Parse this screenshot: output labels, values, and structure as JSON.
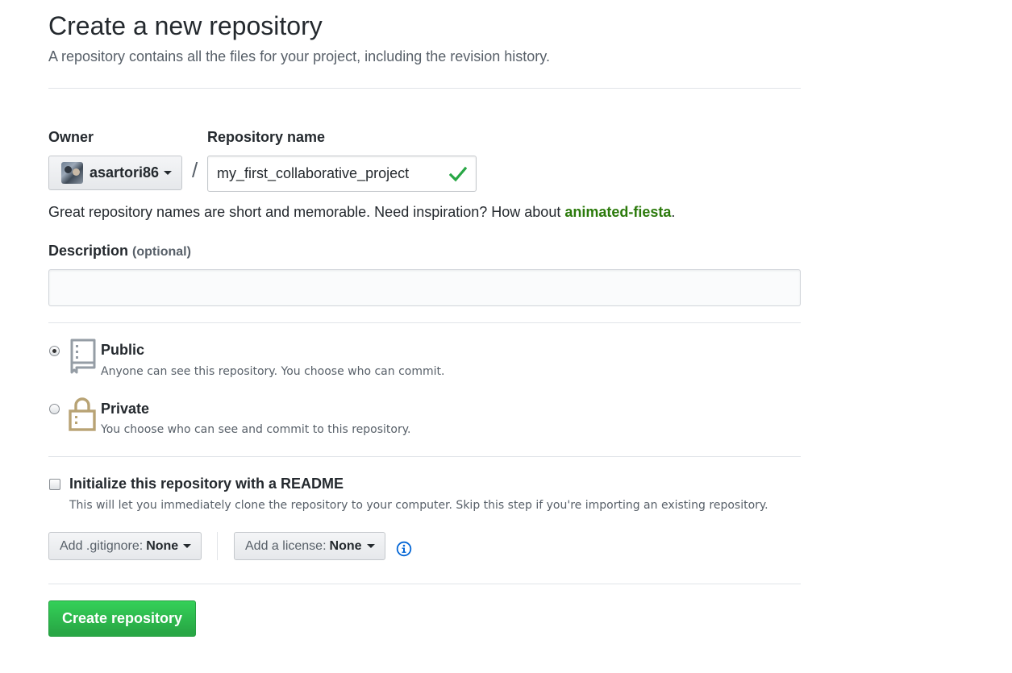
{
  "header": {
    "title": "Create a new repository",
    "subtitle": "A repository contains all the files for your project, including the revision history."
  },
  "owner": {
    "label": "Owner",
    "value": "asartori86"
  },
  "separator": "/",
  "repo_name": {
    "label": "Repository name",
    "value": "my_first_collaborative_project",
    "valid_icon": "check-icon"
  },
  "hint": {
    "text": "Great repository names are short and memorable. Need inspiration? How about",
    "suggestion": "animated-fiesta",
    "end": "."
  },
  "description": {
    "label": "Description",
    "optional": "(optional)",
    "value": ""
  },
  "visibility": {
    "selected": "public",
    "public": {
      "title": "Public",
      "note": "Anyone can see this repository. You choose who can commit.",
      "icon": "repo-icon"
    },
    "private": {
      "title": "Private",
      "note": "You choose who can see and commit to this repository.",
      "icon": "lock-icon"
    }
  },
  "readme": {
    "checked": false,
    "label": "Initialize this repository with a README",
    "note": "This will let you immediately clone the repository to your computer. Skip this step if you're importing an existing repository."
  },
  "gitignore": {
    "label": "Add .gitignore:",
    "value": "None"
  },
  "license": {
    "label": "Add a license:",
    "value": "None",
    "info_icon": "info-icon"
  },
  "submit": {
    "label": "Create repository"
  },
  "colors": {
    "accent_green": "#28a745",
    "suggestion_green": "#2b7a0b",
    "info_blue": "#0366d6",
    "lock_tan": "#b8a374",
    "repo_gray": "#959da5"
  }
}
